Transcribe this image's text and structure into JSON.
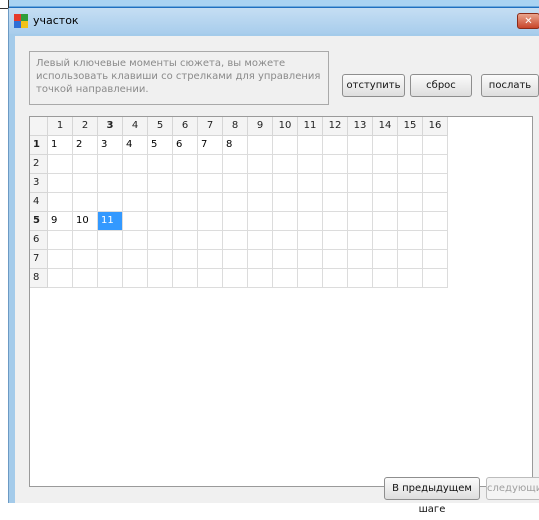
{
  "window": {
    "title": "участок",
    "close_glyph": "✕",
    "icon": "app-multicolor-icon",
    "icon_colors": [
      "#e53b2c",
      "#2f9e3a",
      "#2f6fd6",
      "#f2c218"
    ]
  },
  "instructions": "Левый ключевые моменты сюжета, вы можете использовать клавиши со стрелками для управления точкой направлении.",
  "toolbar": {
    "undo_label": "отступить",
    "reset_label": "сброс",
    "send_label": "послать"
  },
  "grid": {
    "column_headers": [
      "1",
      "2",
      "3",
      "4",
      "5",
      "6",
      "7",
      "8",
      "9",
      "10",
      "11",
      "12",
      "13",
      "14",
      "15",
      "16"
    ],
    "row_headers": [
      "1",
      "2",
      "3",
      "4",
      "5",
      "6",
      "7",
      "8"
    ],
    "bold_column": "3",
    "bold_rows": [
      "1",
      "5"
    ],
    "rows": [
      [
        "1",
        "2",
        "3",
        "4",
        "5",
        "6",
        "7",
        "8",
        "",
        "",
        "",
        "",
        "",
        "",
        "",
        ""
      ],
      [
        "",
        "",
        "",
        "",
        "",
        "",
        "",
        "",
        "",
        "",
        "",
        "",
        "",
        "",
        "",
        ""
      ],
      [
        "",
        "",
        "",
        "",
        "",
        "",
        "",
        "",
        "",
        "",
        "",
        "",
        "",
        "",
        "",
        ""
      ],
      [
        "",
        "",
        "",
        "",
        "",
        "",
        "",
        "",
        "",
        "",
        "",
        "",
        "",
        "",
        "",
        ""
      ],
      [
        "9",
        "10",
        "11",
        "",
        "",
        "",
        "",
        "",
        "",
        "",
        "",
        "",
        "",
        "",
        "",
        ""
      ],
      [
        "",
        "",
        "",
        "",
        "",
        "",
        "",
        "",
        "",
        "",
        "",
        "",
        "",
        "",
        "",
        ""
      ],
      [
        "",
        "",
        "",
        "",
        "",
        "",
        "",
        "",
        "",
        "",
        "",
        "",
        "",
        "",
        "",
        ""
      ],
      [
        "",
        "",
        "",
        "",
        "",
        "",
        "",
        "",
        "",
        "",
        "",
        "",
        "",
        "",
        "",
        ""
      ]
    ],
    "selected_cell": {
      "row": 5,
      "column": 3
    },
    "selection_color": "#3399ff"
  },
  "footer": {
    "prev_label": "В предыдущем шаге",
    "next_label": "следующий"
  }
}
